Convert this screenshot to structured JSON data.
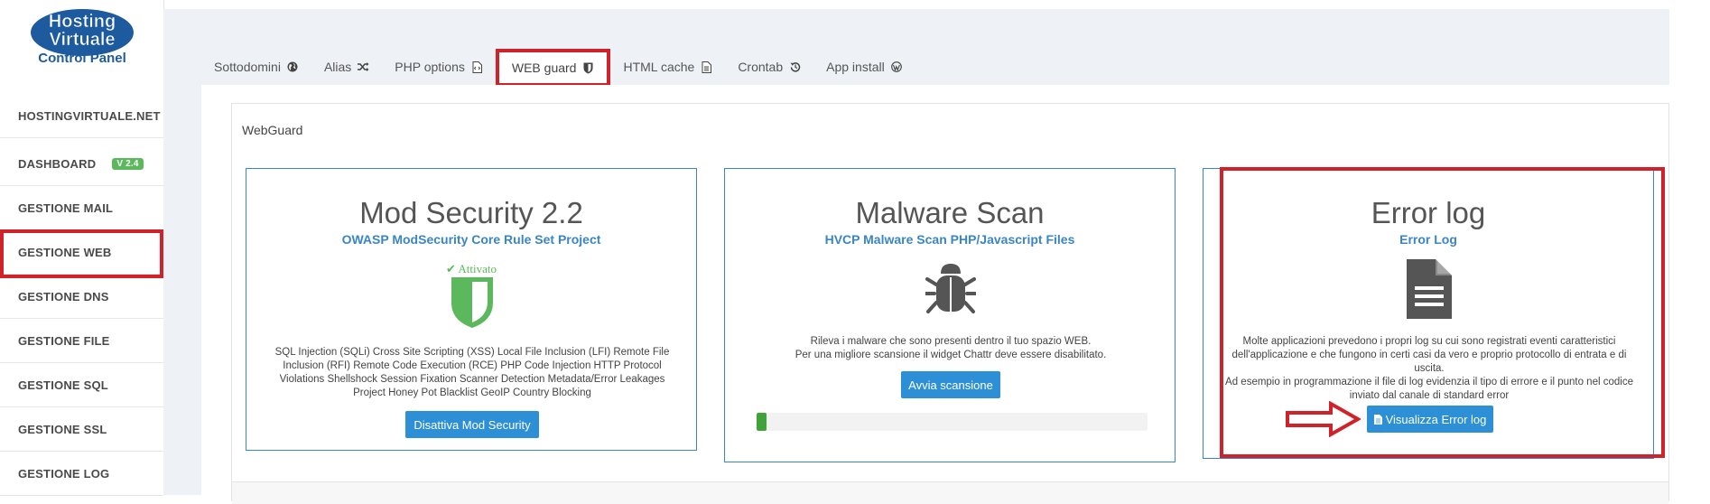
{
  "app": {
    "logo_lines": [
      "Hosting",
      "Virtuale",
      "Control Panel"
    ]
  },
  "sidebar": {
    "items": [
      {
        "label": "HOSTINGVIRTUALE.NET"
      },
      {
        "label": "DASHBOARD",
        "badge": "V 2.4"
      },
      {
        "label": "GESTIONE MAIL"
      },
      {
        "label": "GESTIONE WEB",
        "selected": true
      },
      {
        "label": "GESTIONE DNS"
      },
      {
        "label": "GESTIONE FILE"
      },
      {
        "label": "GESTIONE SQL"
      },
      {
        "label": "GESTIONE SSL"
      },
      {
        "label": "GESTIONE LOG"
      }
    ]
  },
  "tabs": [
    {
      "label": "Sottodomini",
      "icon": "globe-icon"
    },
    {
      "label": "Alias",
      "icon": "shuffle-icon"
    },
    {
      "label": "PHP options",
      "icon": "file-code-icon"
    },
    {
      "label": "WEB guard",
      "icon": "shield-icon",
      "active": true
    },
    {
      "label": "HTML cache",
      "icon": "file-icon"
    },
    {
      "label": "Crontab",
      "icon": "history-icon"
    },
    {
      "label": "App install",
      "icon": "wordpress-icon"
    }
  ],
  "panel": {
    "title": "WebGuard"
  },
  "cards": {
    "modsec": {
      "title": "Mod Security 2.2",
      "subtitle": "OWASP ModSecurity Core Rule Set Project",
      "status": "Attivato",
      "description": "SQL Injection (SQLi) Cross Site Scripting (XSS) Local File Inclusion (LFI) Remote File Inclusion (RFI) Remote Code Execution (RCE) PHP Code Injection HTTP Protocol Violations Shellshock Session Fixation Scanner Detection Metadata/Error Leakages Project Honey Pot Blacklist GeoIP Country Blocking",
      "button": "Disattiva Mod Security"
    },
    "malware": {
      "title": "Malware Scan",
      "subtitle": "HVCP Malware Scan PHP/Javascript Files",
      "description_lines": [
        "Rileva i malware che sono presenti dentro il tuo spazio WEB.",
        "Per una migliore scansione il widget Chattr deve essere disabilitato."
      ],
      "button": "Avvia scansione",
      "progress_fraction": 0.025
    },
    "errorlog": {
      "title": "Error log",
      "subtitle": "Error Log",
      "description": "Molte applicazioni prevedono i propri log su cui sono registrati eventi caratteristici dell'applicazione e che fungono in certi casi da vero e proprio protocollo di entrata e di uscita.",
      "description2": "Ad esempio in programmazione il file di log evidenzia il tipo di errore e il punto nel codice inviato dal canale di standard error",
      "button": "Visualizza Error log"
    }
  },
  "colors": {
    "accent": "#2d8fd5",
    "highlight": "#d0222a",
    "success": "#5cb85c",
    "card_border": "#3a86c4"
  }
}
